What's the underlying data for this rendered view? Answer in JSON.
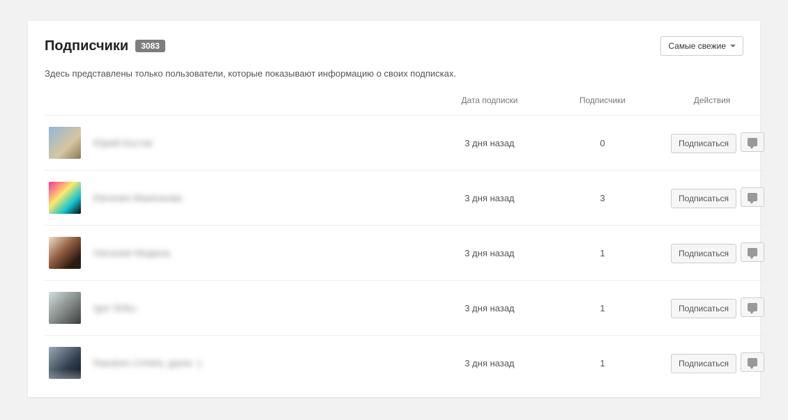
{
  "header": {
    "title": "Подписчики",
    "count": "3083",
    "sort_label": "Самые свежие"
  },
  "subtitle": "Здесь представлены только пользователи, которые показывают информацию о своих подписках.",
  "columns": {
    "date": "Дата подписки",
    "subscribers": "Подписчики",
    "actions": "Действия"
  },
  "actions": {
    "subscribe": "Подписаться"
  },
  "rows": [
    {
      "name": "Юрий Костик",
      "date": "3 дня назад",
      "subscribers": "0",
      "avatar_class": "av1"
    },
    {
      "name": "Евгения Макенкова",
      "date": "3 дня назад",
      "subscribers": "3",
      "avatar_class": "av2"
    },
    {
      "name": "Наталия Модена",
      "date": "3 дня назад",
      "subscribers": "1",
      "avatar_class": "av3"
    },
    {
      "name": "Igor Sirbu",
      "date": "3 дня назад",
      "subscribers": "1",
      "avatar_class": "av4"
    },
    {
      "name": "Random CANAL game :)",
      "date": "3 дня назад",
      "subscribers": "1",
      "avatar_class": "av5"
    }
  ]
}
